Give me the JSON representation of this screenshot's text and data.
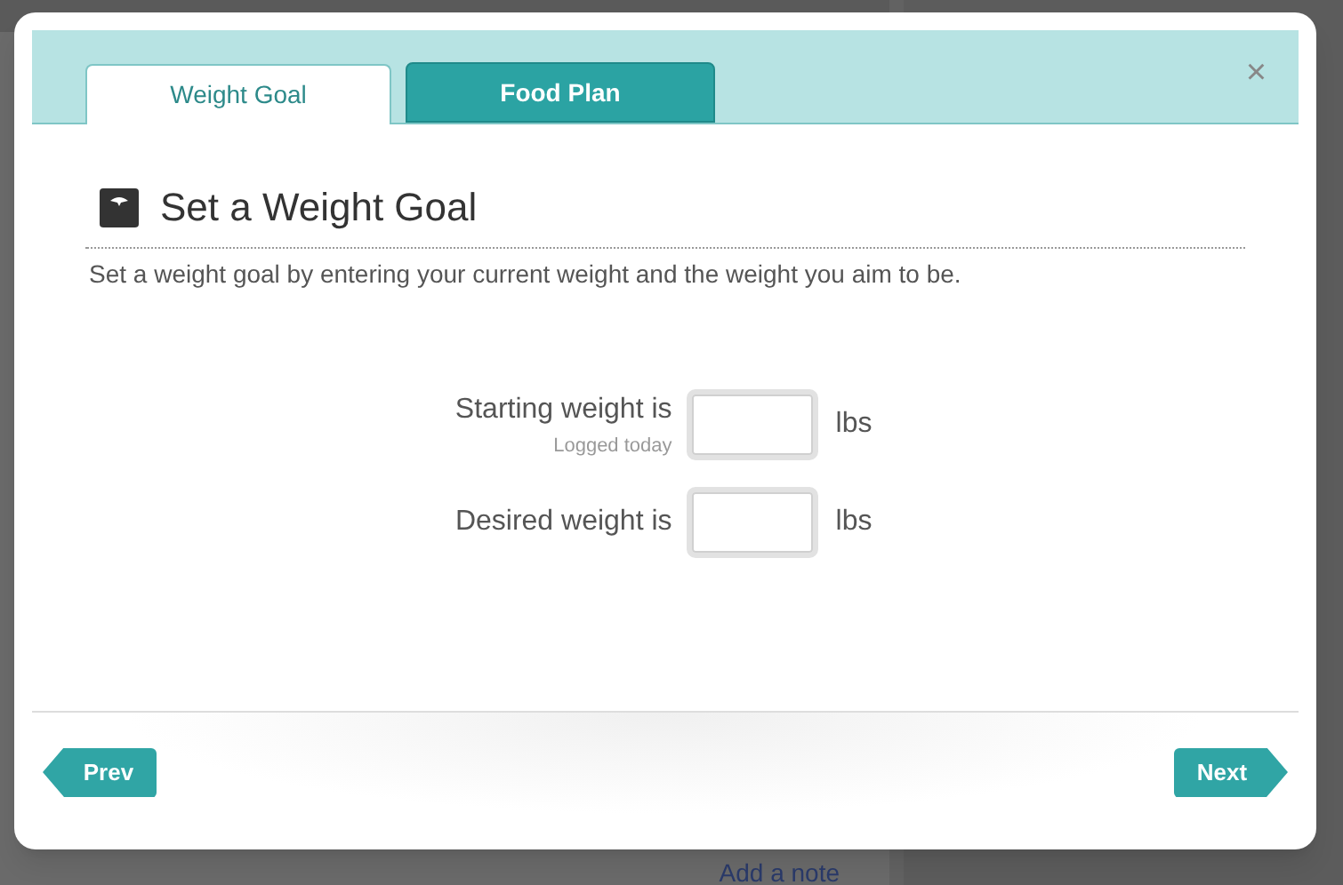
{
  "background": {
    "note_link": "Add a note"
  },
  "dialog": {
    "tabs": [
      {
        "label": "Weight Goal",
        "selected": true
      },
      {
        "label": "Food Plan",
        "selected": false
      }
    ],
    "close": "×",
    "title": "Set a Weight Goal",
    "description": "Set a weight goal by entering your current weight and the weight you aim to be.",
    "fields": [
      {
        "label": "Starting weight is",
        "hint": "Logged today",
        "unit": "lbs"
      },
      {
        "label": "Desired weight is",
        "unit": "lbs"
      }
    ],
    "prev": "Prev",
    "next": "Next"
  }
}
